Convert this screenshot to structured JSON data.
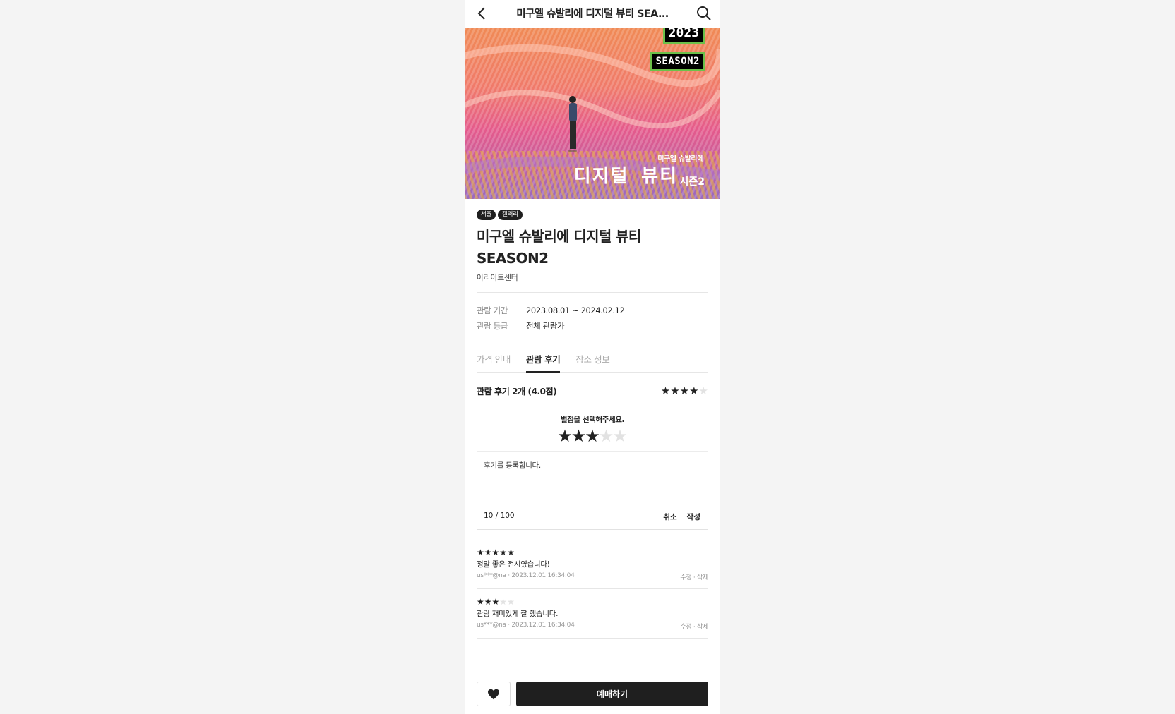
{
  "header": {
    "title": "미구엘 슈발리에 디지털 뷰티 SEA..."
  },
  "poster": {
    "year_badge": "2023",
    "season_badge": "SEASON2",
    "subtitle": "미구엘 슈발리에",
    "main_title": "디지털 뷰티",
    "season_kr": "시즌2"
  },
  "tags": [
    "서울",
    "갤러리"
  ],
  "exhibition": {
    "title_line1": "미구엘 슈발리에 디지털 뷰티",
    "title_line2": "SEASON2",
    "venue": "아라아트센터"
  },
  "info": [
    {
      "label": "관람 기간",
      "value": "2023.08.01 ~ 2024.02.12"
    },
    {
      "label": "관람 등급",
      "value": "전체 관람가"
    }
  ],
  "tabs": [
    {
      "label": "가격 안내",
      "active": false
    },
    {
      "label": "관람 후기",
      "active": true
    },
    {
      "label": "장소 정보",
      "active": false
    }
  ],
  "review_summary": {
    "text": "관람 후기 2개 (4.0점)",
    "rating": 4
  },
  "review_form": {
    "prompt": "별점을 선택해주세요.",
    "rating": 3,
    "text": "후기를 등록합니다.",
    "counter": "10 / 100",
    "cancel_label": "취소",
    "submit_label": "작성"
  },
  "reviews": [
    {
      "rating": 5,
      "text": "정말 좋은 전시였습니다!",
      "meta": "us***@na · 2023.12.01 16:34:04",
      "edit": "수정",
      "sep": "·",
      "delete": "삭제"
    },
    {
      "rating": 3,
      "text": "관람 재미있게 잘 했습니다.",
      "meta": "us***@na · 2023.12.01 16:34:04",
      "edit": "수정",
      "sep": "·",
      "delete": "삭제"
    }
  ],
  "bottom": {
    "book_label": "예매하기"
  }
}
